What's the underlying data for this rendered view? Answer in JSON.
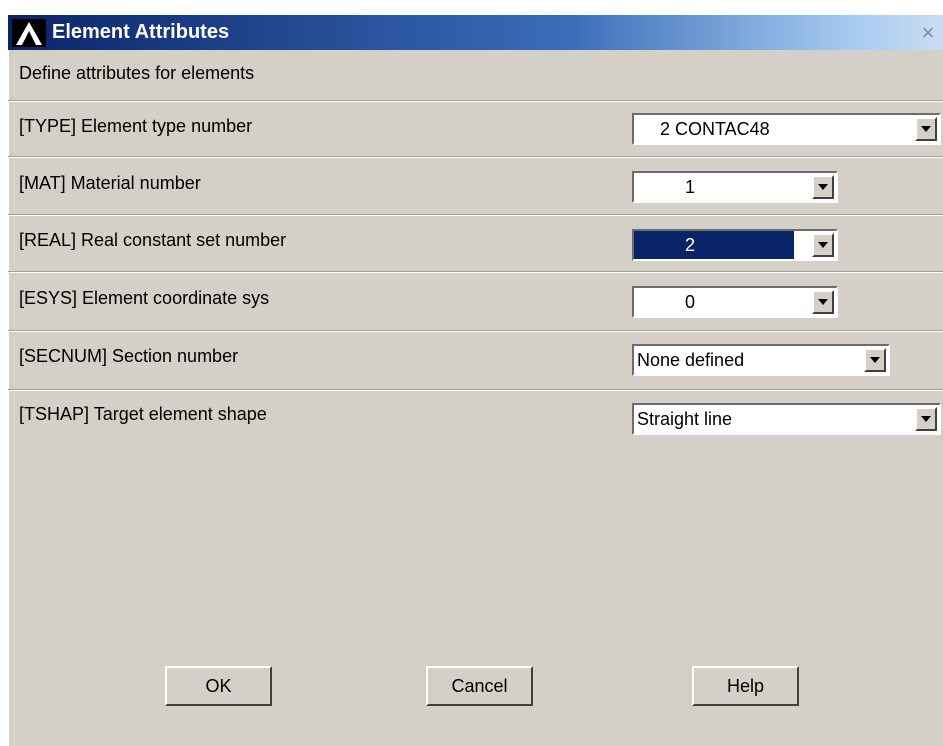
{
  "window": {
    "title": "Element Attributes",
    "close_glyph": "×",
    "logo_icon": "ansys-logo-icon"
  },
  "instruction": "Define attributes for elements",
  "fields": [
    {
      "label": "[TYPE]  Element type number",
      "value": "2   CONTAC48"
    },
    {
      "label": "[MAT]   Material number",
      "value": "1"
    },
    {
      "label": "[REAL]  Real constant set number",
      "value": "2"
    },
    {
      "label": "[ESYS]  Element coordinate sys",
      "value": "0"
    },
    {
      "label": "[SECNUM]  Section number",
      "value": "None defined"
    },
    {
      "label": "[TSHAP]  Target element shape",
      "value": "Straight line"
    }
  ],
  "buttons": {
    "ok": "OK",
    "cancel": "Cancel",
    "help": "Help"
  },
  "colors": {
    "dialog_background": "#d4d0c8",
    "title_gradient_start": "#0a246a",
    "selection": "#0a246a"
  }
}
